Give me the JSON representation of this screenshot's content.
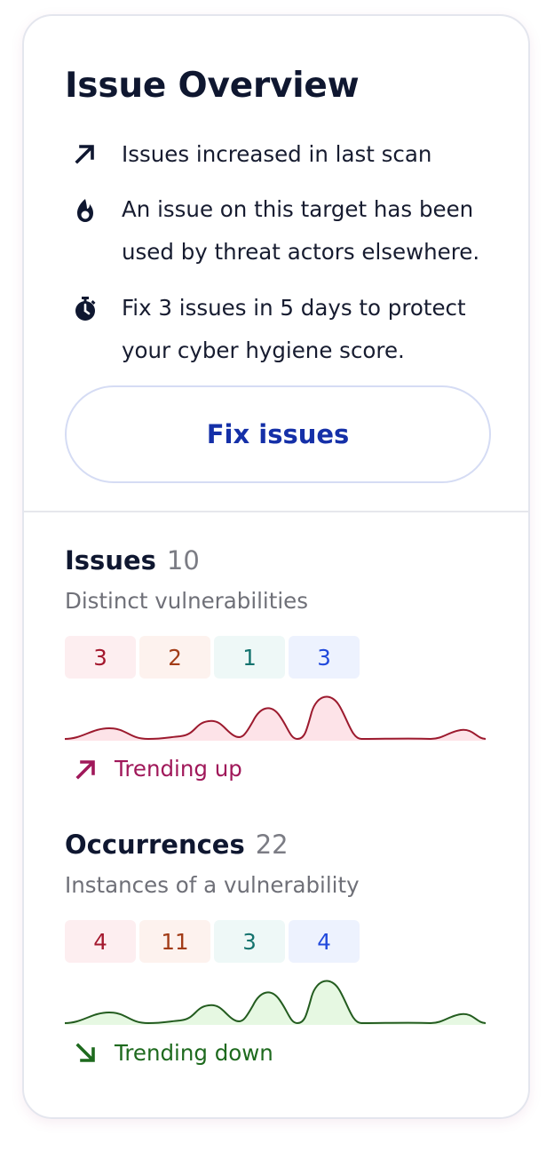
{
  "overview": {
    "title": "Issue Overview",
    "insights": [
      {
        "icon": "arrow-up-right-icon",
        "text": "Issues increased in last scan"
      },
      {
        "icon": "flame-icon",
        "text": "An issue on this target has been used by threat actors elsewhere."
      },
      {
        "icon": "stopwatch-icon",
        "text": "Fix 3 issues in 5 days to protect your cyber hygiene score."
      }
    ],
    "fix_button_label": "Fix issues"
  },
  "metrics": [
    {
      "title": "Issues",
      "count": "10",
      "subtitle": "Distinct vulnerabilities",
      "chips": [
        "3",
        "2",
        "1",
        "3"
      ],
      "trend_label": "Trending up",
      "trend_icon": "arrow-up-right-icon",
      "trend_color": "#a0185a",
      "spark_stroke": "#9c1a2e",
      "spark_fill": "#fde3e8"
    },
    {
      "title": "Occurrences",
      "count": "22",
      "subtitle": "Instances of a vulnerability",
      "chips": [
        "4",
        "11",
        "3",
        "4"
      ],
      "trend_label": "Trending down",
      "trend_icon": "arrow-down-right-icon",
      "trend_color": "#1e6a1e",
      "spark_stroke": "#235c1f",
      "spark_fill": "#e6f8e2"
    }
  ],
  "colors": {
    "chip_critical_bg": "#fdeef0",
    "chip_critical_text": "#a4182e",
    "chip_high_bg": "#fdf2ee",
    "chip_high_text": "#a23c17",
    "chip_medium_bg": "#eef8f7",
    "chip_medium_text": "#14736e",
    "chip_low_bg": "#edf2fe",
    "chip_low_text": "#2149dc",
    "button_text": "#1530a8"
  }
}
